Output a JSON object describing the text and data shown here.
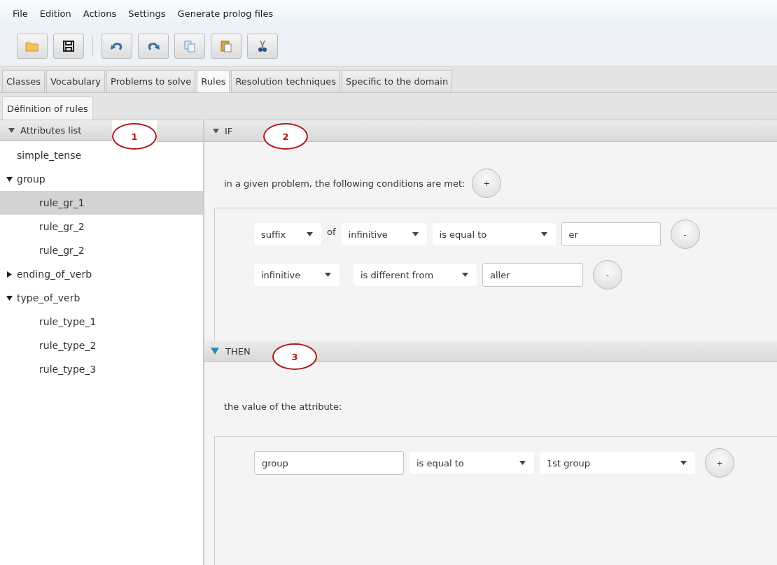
{
  "menu": [
    "File",
    "Edition",
    "Actions",
    "Settings",
    "Generate prolog files"
  ],
  "toolbar": [
    {
      "kind": "open"
    },
    {
      "kind": "save"
    },
    {
      "kind": "undo"
    },
    {
      "kind": "redo"
    },
    {
      "kind": "copy"
    },
    {
      "kind": "paste"
    },
    {
      "kind": "cut"
    }
  ],
  "tabs": [
    {
      "label": "Classes",
      "selected": false
    },
    {
      "label": "Vocabulary",
      "selected": false
    },
    {
      "label": "Problems to solve",
      "selected": false
    },
    {
      "label": "Rules",
      "selected": true
    },
    {
      "label": "Resolution techniques",
      "selected": false
    },
    {
      "label": "Specific to the domain",
      "selected": false
    }
  ],
  "subtabs": [
    {
      "label": "Définition of rules",
      "selected": true
    }
  ],
  "attributes": {
    "title": "Attributes list",
    "expanded": true,
    "callout": "1",
    "items": [
      {
        "label": "simple_tense",
        "selected": false
      },
      {
        "label": "group",
        "selected": false,
        "expanded": true,
        "children": [
          {
            "label": "rule_gr_1",
            "selected": true
          },
          {
            "label": "rule_gr_2",
            "selected": false
          },
          {
            "label": "rule_gr_2",
            "selected": false
          }
        ]
      },
      {
        "label": "ending_of_verb",
        "selected": false,
        "expanded": false
      },
      {
        "label": "type_of_verb",
        "selected": false,
        "expanded": true,
        "children": [
          {
            "label": "rule_type_1",
            "selected": false
          },
          {
            "label": "rule_type_2",
            "selected": false
          },
          {
            "label": "rule_type_3",
            "selected": false
          }
        ]
      }
    ]
  },
  "if_section": {
    "title": "IF",
    "expanded": true,
    "focused": false,
    "callout": "2",
    "sentence": "in a given problem, the following conditions are met:",
    "add_button": "+",
    "conditions": [
      [
        {
          "kind": "dropdown",
          "value": "suffix"
        },
        {
          "kind": "text",
          "value": "of"
        },
        {
          "kind": "dropdown",
          "value": "infinitive"
        },
        {
          "kind": "dropdown",
          "value": "is equal to"
        },
        {
          "kind": "input",
          "value": "er"
        },
        {
          "kind": "button",
          "value": "-"
        }
      ],
      [
        {
          "kind": "dropdown",
          "value": "infinitive"
        },
        {
          "kind": "dropdown",
          "value": "is different from"
        },
        {
          "kind": "input",
          "value": "aller"
        },
        {
          "kind": "button",
          "value": "-"
        }
      ]
    ]
  },
  "then_section": {
    "title": "THEN",
    "expanded": true,
    "focused": true,
    "callout": "3",
    "sentence": "the value of the attribute:",
    "conditions": [
      [
        {
          "kind": "input",
          "value": "group"
        },
        {
          "kind": "dropdown",
          "value": "is equal to"
        },
        {
          "kind": "dropdown",
          "value": "1st group"
        },
        {
          "kind": "button",
          "value": "+"
        }
      ]
    ]
  }
}
